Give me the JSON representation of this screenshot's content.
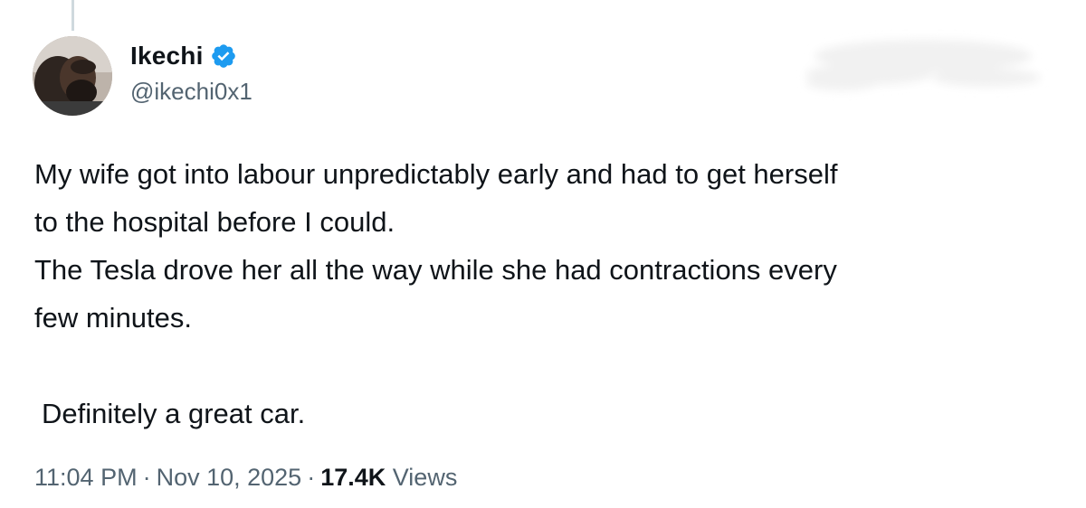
{
  "tweet": {
    "author": {
      "name": "Ikechi",
      "handle": "@ikechi0x1",
      "verified_color": "#1d9bf0"
    },
    "body": {
      "line1": "My wife got into labour unpredictably early and had to get herself",
      "line2": "to the hospital before I could.",
      "line3": "The Tesla drove her all the way while she had contractions every",
      "line4": "few minutes.",
      "line5": "Definitely a great car."
    },
    "meta": {
      "time": "11:04 PM",
      "separator": "·",
      "date": "Nov 10, 2025",
      "views_count": "17.4K",
      "views_label": "Views"
    }
  }
}
